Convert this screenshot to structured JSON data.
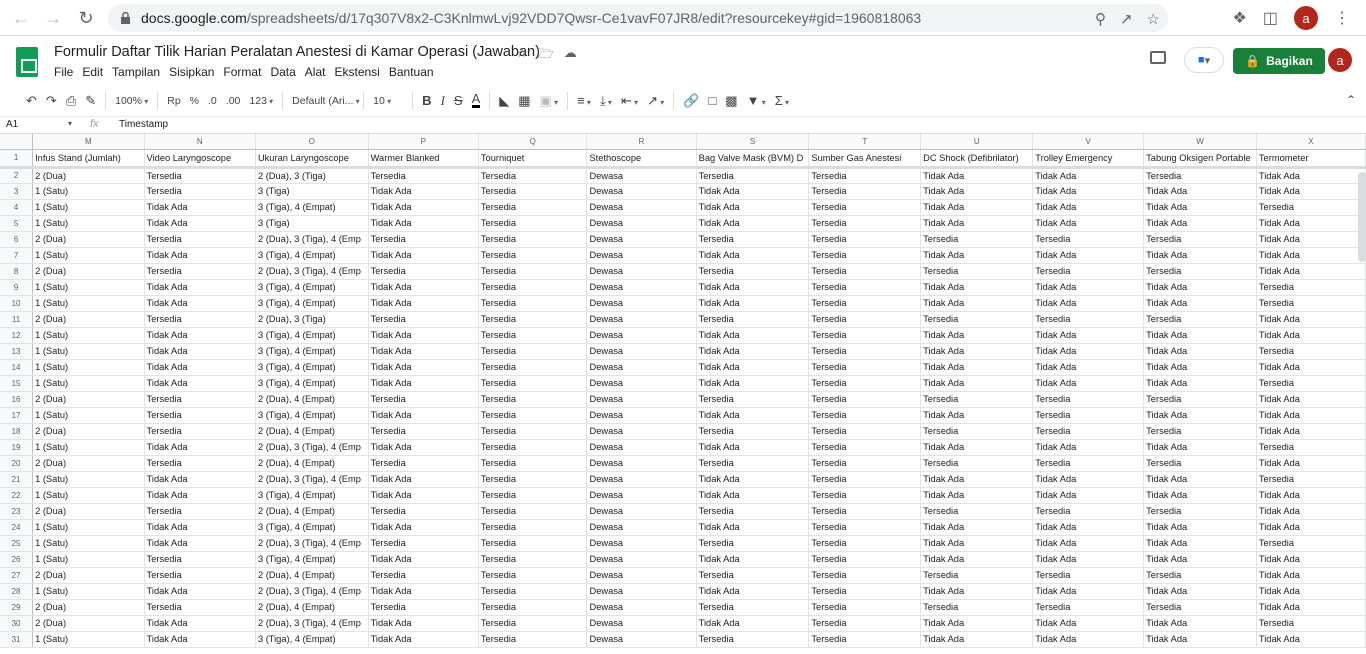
{
  "browser": {
    "url_host": "docs.google.com",
    "url_path": "/spreadsheets/d/17q307V8x2-C3KnlmwLvj92VDD7Qwsr-Ce1vavF07JR8/edit?resourcekey#gid=1960818063",
    "profile_initial": "a"
  },
  "doc": {
    "title": "Formulir Daftar Tilik Harian Peralatan Anestesi di Kamar Operasi (Jawaban)",
    "menu": [
      "File",
      "Edit",
      "Tampilan",
      "Sisipkan",
      "Format",
      "Data",
      "Alat",
      "Ekstensi",
      "Bantuan"
    ],
    "share_label": "Bagikan",
    "avatar_initial": "a"
  },
  "toolbar": {
    "zoom": "100%",
    "currency": "Rp",
    "percent": "%",
    "dec_decrease": ".0",
    "dec_increase": ".00",
    "number_format": "123",
    "font": "Default (Ari...",
    "font_size": "10"
  },
  "formula": {
    "cell_ref": "A1",
    "fx": "fx",
    "value": "Timestamp"
  },
  "grid": {
    "columns": [
      "M",
      "N",
      "O",
      "P",
      "Q",
      "R",
      "S",
      "T",
      "U",
      "V",
      "W",
      "X"
    ],
    "headers": [
      "Infus Stand (Jumlah)",
      "Video Laryngoscope",
      "Ukuran Laryngoscope",
      "Warmer Blanked",
      "Tourniquet",
      "Stethoscope",
      "Bag Valve Mask (BVM) D",
      "Sumber Gas Anestesi",
      "DC Shock (Defibrilator)",
      "Trolley Emergency",
      "Tabung Oksigen Portable",
      "Termometer"
    ],
    "rows": [
      [
        "2",
        "2 (Dua)",
        "Tersedia",
        "2 (Dua), 3 (Tiga)",
        "Tersedia",
        "Tersedia",
        "Dewasa",
        "Tersedia",
        "Tersedia",
        "Tidak Ada",
        "Tidak Ada",
        "Tersedia",
        "Tidak Ada"
      ],
      [
        "3",
        "1 (Satu)",
        "Tersedia",
        "3 (Tiga)",
        "Tidak Ada",
        "Tersedia",
        "Dewasa",
        "Tidak Ada",
        "Tersedia",
        "Tidak Ada",
        "Tidak Ada",
        "Tidak Ada",
        "Tidak Ada"
      ],
      [
        "4",
        "1 (Satu)",
        "Tidak Ada",
        "3 (Tiga), 4 (Empat)",
        "Tidak Ada",
        "Tersedia",
        "Dewasa",
        "Tidak Ada",
        "Tersedia",
        "Tidak Ada",
        "Tidak Ada",
        "Tidak Ada",
        "Tersedia"
      ],
      [
        "5",
        "1 (Satu)",
        "Tidak Ada",
        "3 (Tiga)",
        "Tidak Ada",
        "Tersedia",
        "Dewasa",
        "Tidak Ada",
        "Tersedia",
        "Tidak Ada",
        "Tidak Ada",
        "Tidak Ada",
        "Tidak Ada"
      ],
      [
        "6",
        "2 (Dua)",
        "Tersedia",
        "2 (Dua), 3 (Tiga), 4 (Emp",
        "Tersedia",
        "Tersedia",
        "Dewasa",
        "Tersedia",
        "Tersedia",
        "Tersedia",
        "Tersedia",
        "Tersedia",
        "Tidak Ada"
      ],
      [
        "7",
        "1 (Satu)",
        "Tidak Ada",
        "3 (Tiga), 4 (Empat)",
        "Tidak Ada",
        "Tersedia",
        "Dewasa",
        "Tidak Ada",
        "Tersedia",
        "Tidak Ada",
        "Tidak Ada",
        "Tidak Ada",
        "Tidak Ada"
      ],
      [
        "8",
        "2 (Dua)",
        "Tersedia",
        "2 (Dua), 3 (Tiga), 4 (Emp",
        "Tersedia",
        "Tersedia",
        "Dewasa",
        "Tersedia",
        "Tersedia",
        "Tersedia",
        "Tersedia",
        "Tersedia",
        "Tidak Ada"
      ],
      [
        "9",
        "1 (Satu)",
        "Tidak Ada",
        "3 (Tiga), 4 (Empat)",
        "Tidak Ada",
        "Tersedia",
        "Dewasa",
        "Tidak Ada",
        "Tersedia",
        "Tidak Ada",
        "Tidak Ada",
        "Tidak Ada",
        "Tersedia"
      ],
      [
        "10",
        "1 (Satu)",
        "Tidak Ada",
        "3 (Tiga), 4 (Empat)",
        "Tidak Ada",
        "Tersedia",
        "Dewasa",
        "Tidak Ada",
        "Tersedia",
        "Tidak Ada",
        "Tidak Ada",
        "Tidak Ada",
        "Tersedia"
      ],
      [
        "11",
        "2 (Dua)",
        "Tersedia",
        "2 (Dua), 3 (Tiga)",
        "Tersedia",
        "Tersedia",
        "Dewasa",
        "Tersedia",
        "Tersedia",
        "Tersedia",
        "Tersedia",
        "Tersedia",
        "Tidak Ada"
      ],
      [
        "12",
        "1 (Satu)",
        "Tidak Ada",
        "3 (Tiga), 4 (Empat)",
        "Tidak Ada",
        "Tersedia",
        "Dewasa",
        "Tidak Ada",
        "Tersedia",
        "Tidak Ada",
        "Tidak Ada",
        "Tidak Ada",
        "Tidak Ada"
      ],
      [
        "13",
        "1 (Satu)",
        "Tidak Ada",
        "3 (Tiga), 4 (Empat)",
        "Tidak Ada",
        "Tersedia",
        "Dewasa",
        "Tidak Ada",
        "Tersedia",
        "Tidak Ada",
        "Tidak Ada",
        "Tidak Ada",
        "Tersedia"
      ],
      [
        "14",
        "1 (Satu)",
        "Tidak Ada",
        "3 (Tiga), 4 (Empat)",
        "Tidak Ada",
        "Tersedia",
        "Dewasa",
        "Tidak Ada",
        "Tersedia",
        "Tidak Ada",
        "Tidak Ada",
        "Tidak Ada",
        "Tidak Ada"
      ],
      [
        "15",
        "1 (Satu)",
        "Tidak Ada",
        "3 (Tiga), 4 (Empat)",
        "Tidak Ada",
        "Tersedia",
        "Dewasa",
        "Tidak Ada",
        "Tersedia",
        "Tidak Ada",
        "Tidak Ada",
        "Tidak Ada",
        "Tersedia"
      ],
      [
        "16",
        "2 (Dua)",
        "Tersedia",
        "2 (Dua), 4 (Empat)",
        "Tersedia",
        "Tersedia",
        "Dewasa",
        "Tersedia",
        "Tersedia",
        "Tersedia",
        "Tersedia",
        "Tersedia",
        "Tidak Ada"
      ],
      [
        "17",
        "1 (Satu)",
        "Tersedia",
        "3 (Tiga), 4 (Empat)",
        "Tidak Ada",
        "Tersedia",
        "Dewasa",
        "Tidak Ada",
        "Tersedia",
        "Tidak Ada",
        "Tersedia",
        "Tidak Ada",
        "Tidak Ada"
      ],
      [
        "18",
        "2 (Dua)",
        "Tersedia",
        "2 (Dua), 4 (Empat)",
        "Tersedia",
        "Tersedia",
        "Dewasa",
        "Tersedia",
        "Tersedia",
        "Tersedia",
        "Tersedia",
        "Tersedia",
        "Tidak Ada"
      ],
      [
        "19",
        "1 (Satu)",
        "Tidak Ada",
        "2 (Dua), 3 (Tiga), 4 (Emp",
        "Tidak Ada",
        "Tersedia",
        "Dewasa",
        "Tidak Ada",
        "Tersedia",
        "Tidak Ada",
        "Tidak Ada",
        "Tidak Ada",
        "Tersedia"
      ],
      [
        "20",
        "2 (Dua)",
        "Tersedia",
        "2 (Dua), 4 (Empat)",
        "Tersedia",
        "Tersedia",
        "Dewasa",
        "Tersedia",
        "Tersedia",
        "Tersedia",
        "Tersedia",
        "Tersedia",
        "Tidak Ada"
      ],
      [
        "21",
        "1 (Satu)",
        "Tidak Ada",
        "2 (Dua), 3 (Tiga), 4 (Emp",
        "Tidak Ada",
        "Tersedia",
        "Dewasa",
        "Tidak Ada",
        "Tersedia",
        "Tidak Ada",
        "Tidak Ada",
        "Tidak Ada",
        "Tersedia"
      ],
      [
        "22",
        "1 (Satu)",
        "Tidak Ada",
        "3 (Tiga), 4 (Empat)",
        "Tidak Ada",
        "Tersedia",
        "Dewasa",
        "Tidak Ada",
        "Tersedia",
        "Tidak Ada",
        "Tidak Ada",
        "Tidak Ada",
        "Tidak Ada"
      ],
      [
        "23",
        "2 (Dua)",
        "Tersedia",
        "2 (Dua), 4 (Empat)",
        "Tersedia",
        "Tersedia",
        "Dewasa",
        "Tersedia",
        "Tersedia",
        "Tersedia",
        "Tersedia",
        "Tersedia",
        "Tidak Ada"
      ],
      [
        "24",
        "1 (Satu)",
        "Tidak Ada",
        "3 (Tiga), 4 (Empat)",
        "Tidak Ada",
        "Tersedia",
        "Dewasa",
        "Tidak Ada",
        "Tersedia",
        "Tidak Ada",
        "Tidak Ada",
        "Tidak Ada",
        "Tidak Ada"
      ],
      [
        "25",
        "1 (Satu)",
        "Tidak Ada",
        "2 (Dua), 3 (Tiga), 4 (Emp",
        "Tersedia",
        "Tersedia",
        "Dewasa",
        "Tersedia",
        "Tersedia",
        "Tidak Ada",
        "Tidak Ada",
        "Tidak Ada",
        "Tersedia"
      ],
      [
        "26",
        "1 (Satu)",
        "Tersedia",
        "3 (Tiga), 4 (Empat)",
        "Tidak Ada",
        "Tersedia",
        "Dewasa",
        "Tidak Ada",
        "Tersedia",
        "Tidak Ada",
        "Tidak Ada",
        "Tidak Ada",
        "Tidak Ada"
      ],
      [
        "27",
        "2 (Dua)",
        "Tersedia",
        "2 (Dua), 4 (Empat)",
        "Tersedia",
        "Tersedia",
        "Dewasa",
        "Tersedia",
        "Tersedia",
        "Tersedia",
        "Tersedia",
        "Tersedia",
        "Tidak Ada"
      ],
      [
        "28",
        "1 (Satu)",
        "Tidak Ada",
        "2 (Dua), 3 (Tiga), 4 (Emp",
        "Tidak Ada",
        "Tersedia",
        "Dewasa",
        "Tidak Ada",
        "Tersedia",
        "Tidak Ada",
        "Tidak Ada",
        "Tidak Ada",
        "Tidak Ada"
      ],
      [
        "29",
        "2 (Dua)",
        "Tersedia",
        "2 (Dua), 4 (Empat)",
        "Tersedia",
        "Tersedia",
        "Dewasa",
        "Tersedia",
        "Tersedia",
        "Tersedia",
        "Tersedia",
        "Tersedia",
        "Tidak Ada"
      ],
      [
        "30",
        "2 (Dua)",
        "Tidak Ada",
        "2 (Dua), 3 (Tiga), 4 (Emp",
        "Tidak Ada",
        "Tersedia",
        "Dewasa",
        "Tidak Ada",
        "Tersedia",
        "Tidak Ada",
        "Tidak Ada",
        "Tidak Ada",
        "Tersedia"
      ],
      [
        "31",
        "1 (Satu)",
        "Tidak Ada",
        "3 (Tiga), 4 (Empat)",
        "Tidak Ada",
        "Tersedia",
        "Dewasa",
        "Tersedia",
        "Tersedia",
        "Tidak Ada",
        "Tidak Ada",
        "Tidak Ada",
        "Tidak Ada"
      ]
    ]
  },
  "colors": {
    "share_button": "#188038",
    "sheets_logo": "#0f9d58",
    "avatar": "#b3261e"
  }
}
